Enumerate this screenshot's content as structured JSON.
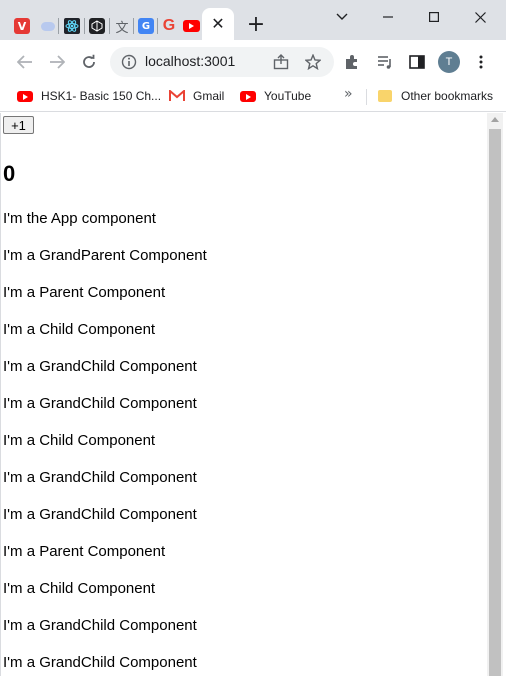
{
  "browser": {
    "tabs": [
      {
        "icon": "vivaldi-icon",
        "color": "#e53935"
      },
      {
        "icon": "cloud-icon",
        "color": "#9fb6e8"
      },
      {
        "icon": "react-icon",
        "color": "#61dafb"
      },
      {
        "icon": "codepen-icon",
        "color": "#202124"
      },
      {
        "icon": "dictionary-icon",
        "color": "#5f6368"
      },
      {
        "icon": "google-translate-icon",
        "color": "#4285f4"
      },
      {
        "icon": "google-icon",
        "color": "#ea4335"
      },
      {
        "icon": "youtube-icon",
        "color": "#ff0000"
      }
    ],
    "active_tab_close": "✕",
    "new_tab": "+",
    "url": "localhost:3001",
    "profile_initial": "T",
    "bookmarks": [
      {
        "icon": "youtube-icon",
        "label": "HSK1- Basic 150 Ch..."
      },
      {
        "icon": "gmail-icon",
        "label": "Gmail"
      },
      {
        "icon": "youtube-icon",
        "label": "YouTube"
      }
    ],
    "more_bookmarks": "»",
    "other_bookmarks": "Other bookmarks"
  },
  "app": {
    "increment_label": "+1",
    "count": "0",
    "lines": [
      "I'm the App component",
      "I'm a GrandParent Component",
      "I'm a Parent Component",
      "I'm a Child Component",
      "I'm a GrandChild Component",
      "I'm a GrandChild Component",
      "I'm a Child Component",
      "I'm a GrandChild Component",
      "I'm a GrandChild Component",
      "I'm a Parent Component",
      "I'm a Child Component",
      "I'm a GrandChild Component",
      "I'm a GrandChild Component"
    ]
  }
}
